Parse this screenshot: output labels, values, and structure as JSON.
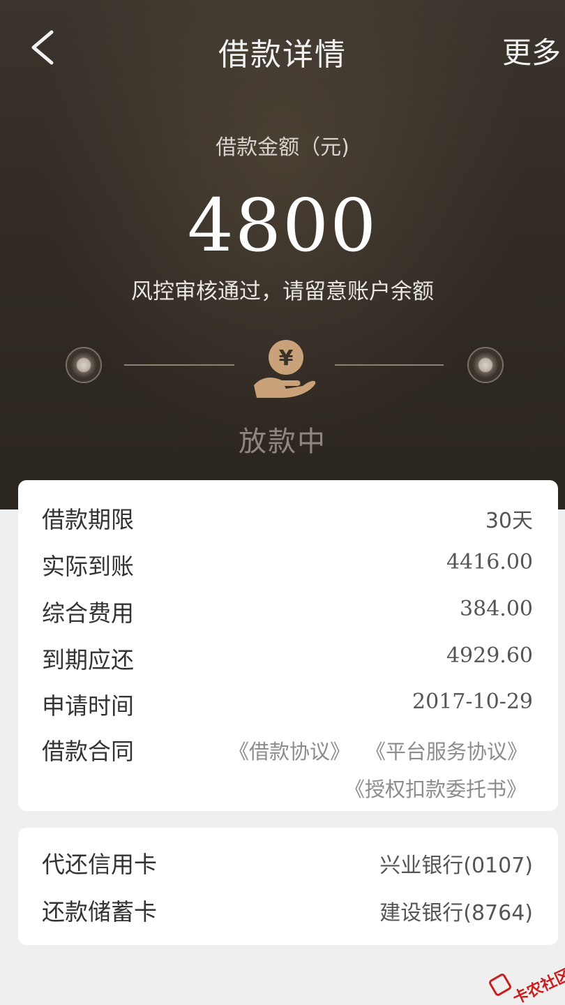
{
  "nav": {
    "title": "借款详情",
    "more_label": "更多"
  },
  "loan": {
    "amount_label": "借款金额（元)",
    "amount": "4800",
    "status_note": "风控审核通过，请留意账户余额"
  },
  "progress": {
    "current_step_label": "放款中",
    "current_step_icon": "yen-hand-icon"
  },
  "details": [
    {
      "label": "借款期限",
      "value": "30天"
    },
    {
      "label": "实际到账",
      "value": "4416.00"
    },
    {
      "label": "综合费用",
      "value": "384.00"
    },
    {
      "label": "到期应还",
      "value": "4929.60"
    },
    {
      "label": "申请时间",
      "value": "2017-10-29"
    }
  ],
  "contract": {
    "label": "借款合同",
    "links": [
      "《借款协议》",
      "《平台服务协议》",
      "《授权扣款委托书》"
    ]
  },
  "cards": [
    {
      "label": "代还信用卡",
      "value": "兴业银行(0107)"
    },
    {
      "label": "还款储蓄卡",
      "value": "建设银行(8764)"
    }
  ],
  "watermark": {
    "text": "卡农社区"
  },
  "colors": {
    "hero_bg": "#332c25",
    "icon_gold": "#c9a27a",
    "card_bg": "#ffffff",
    "page_bg": "#efefef",
    "link_gray": "#8c8c8c",
    "watermark_red": "#c81e1e"
  }
}
